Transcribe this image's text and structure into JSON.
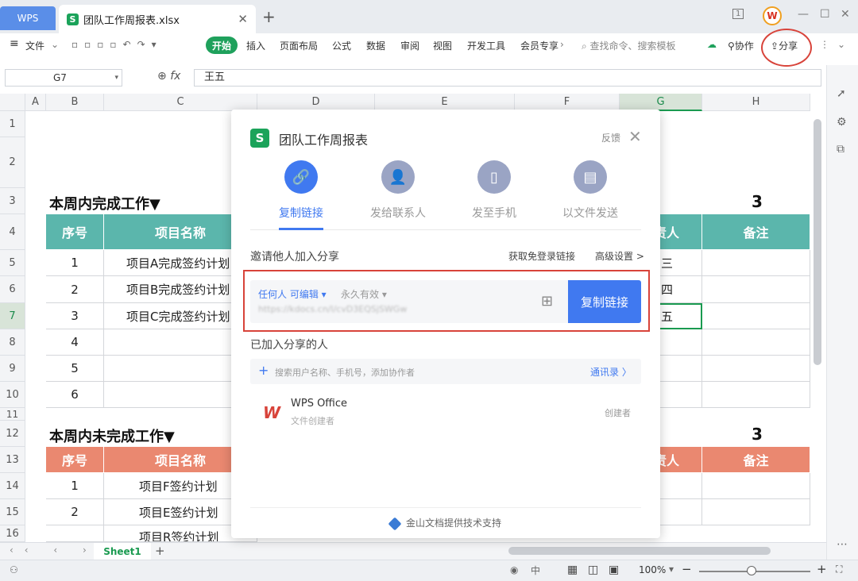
{
  "window": {
    "app_tab": "WPS",
    "file_tab": "团队工作周报表.xlsx",
    "s_glyph": "S",
    "close_glyph": "✕",
    "add_glyph": "+",
    "min_glyph": "—",
    "max_glyph": "☐",
    "winclose_glyph": "✕",
    "page_glyph": "1",
    "avatar_glyph": "W"
  },
  "ribbon": {
    "file": "文件",
    "tabs": [
      "开始",
      "插入",
      "页面布局",
      "公式",
      "数据",
      "审阅",
      "视图",
      "开发工具",
      "会员专享"
    ],
    "search_placeholder": "查找命令、搜索模板",
    "collab": "协作",
    "share": "分享"
  },
  "formula_bar": {
    "cell_ref": "G7",
    "fx": "fx",
    "value": "王五"
  },
  "columns": [
    "A",
    "B",
    "C",
    "D",
    "E",
    "F",
    "G",
    "H"
  ],
  "rows": [
    "1",
    "2",
    "3",
    "4",
    "5",
    "6",
    "7",
    "8",
    "9",
    "10",
    "11",
    "12",
    "13",
    "14",
    "15",
    "16"
  ],
  "sheet": {
    "section1_title": "本周内完成工作▼",
    "section1_count": "3",
    "headers": {
      "seq": "序号",
      "project": "项目名称",
      "owner_partial": "责人",
      "note": "备注"
    },
    "completed": [
      {
        "seq": "1",
        "project": "项目A完成签约计划",
        "owner": "三"
      },
      {
        "seq": "2",
        "project": "项目B完成签约计划",
        "owner": "四"
      },
      {
        "seq": "3",
        "project": "项目C完成签约计划",
        "owner": "五"
      },
      {
        "seq": "4",
        "project": "",
        "owner": ""
      },
      {
        "seq": "5",
        "project": "",
        "owner": ""
      },
      {
        "seq": "6",
        "project": "",
        "owner": ""
      }
    ],
    "section2_title": "本周内未完成工作▼",
    "section2_count": "3",
    "incomplete": [
      {
        "seq": "1",
        "project": "项目F签约计划"
      },
      {
        "seq": "2",
        "project": "项目E签约计划"
      },
      {
        "seq": "",
        "project": "项目R签约计划"
      }
    ]
  },
  "sheet_tabs": {
    "active": "Sheet1",
    "add": "+"
  },
  "status": {
    "zoom": "100%"
  },
  "dialog": {
    "title": "团队工作周报表",
    "feedback": "反馈",
    "close": "✕",
    "options": [
      {
        "label": "复制链接",
        "icon": "link-icon",
        "glyph": "🔗"
      },
      {
        "label": "发给联系人",
        "icon": "contact-icon",
        "glyph": "👤"
      },
      {
        "label": "发至手机",
        "icon": "phone-icon",
        "glyph": "▯"
      },
      {
        "label": "以文件发送",
        "icon": "file-icon",
        "glyph": "▤"
      }
    ],
    "invite_title": "邀请他人加入分享",
    "no_login_link": "获取免登录链接",
    "advanced": "高级设置 >",
    "permission": "任何人 可编辑 ▾",
    "validity": "永久有效 ▾",
    "url": "https://kdocs.cn/l/cvD3EQSjSWGw",
    "qr_glyph": "⊞",
    "copy_button": "复制链接",
    "joined_title": "已加入分享的人",
    "plus_glyph": "+",
    "search_placeholder": "搜索用户名称、手机号，添加协作者",
    "contacts": "通讯录 〉",
    "member": {
      "logo": "W",
      "name": "WPS Office",
      "role": "文件创建者",
      "badge": "创建者"
    },
    "footer": "金山文档提供技术支持"
  },
  "colors": {
    "accent": "#4079f0",
    "green": "#1fa15c",
    "teal_header": "#5bb6ac",
    "orange_header": "#ea8870",
    "highlight_red": "#d8433a"
  }
}
